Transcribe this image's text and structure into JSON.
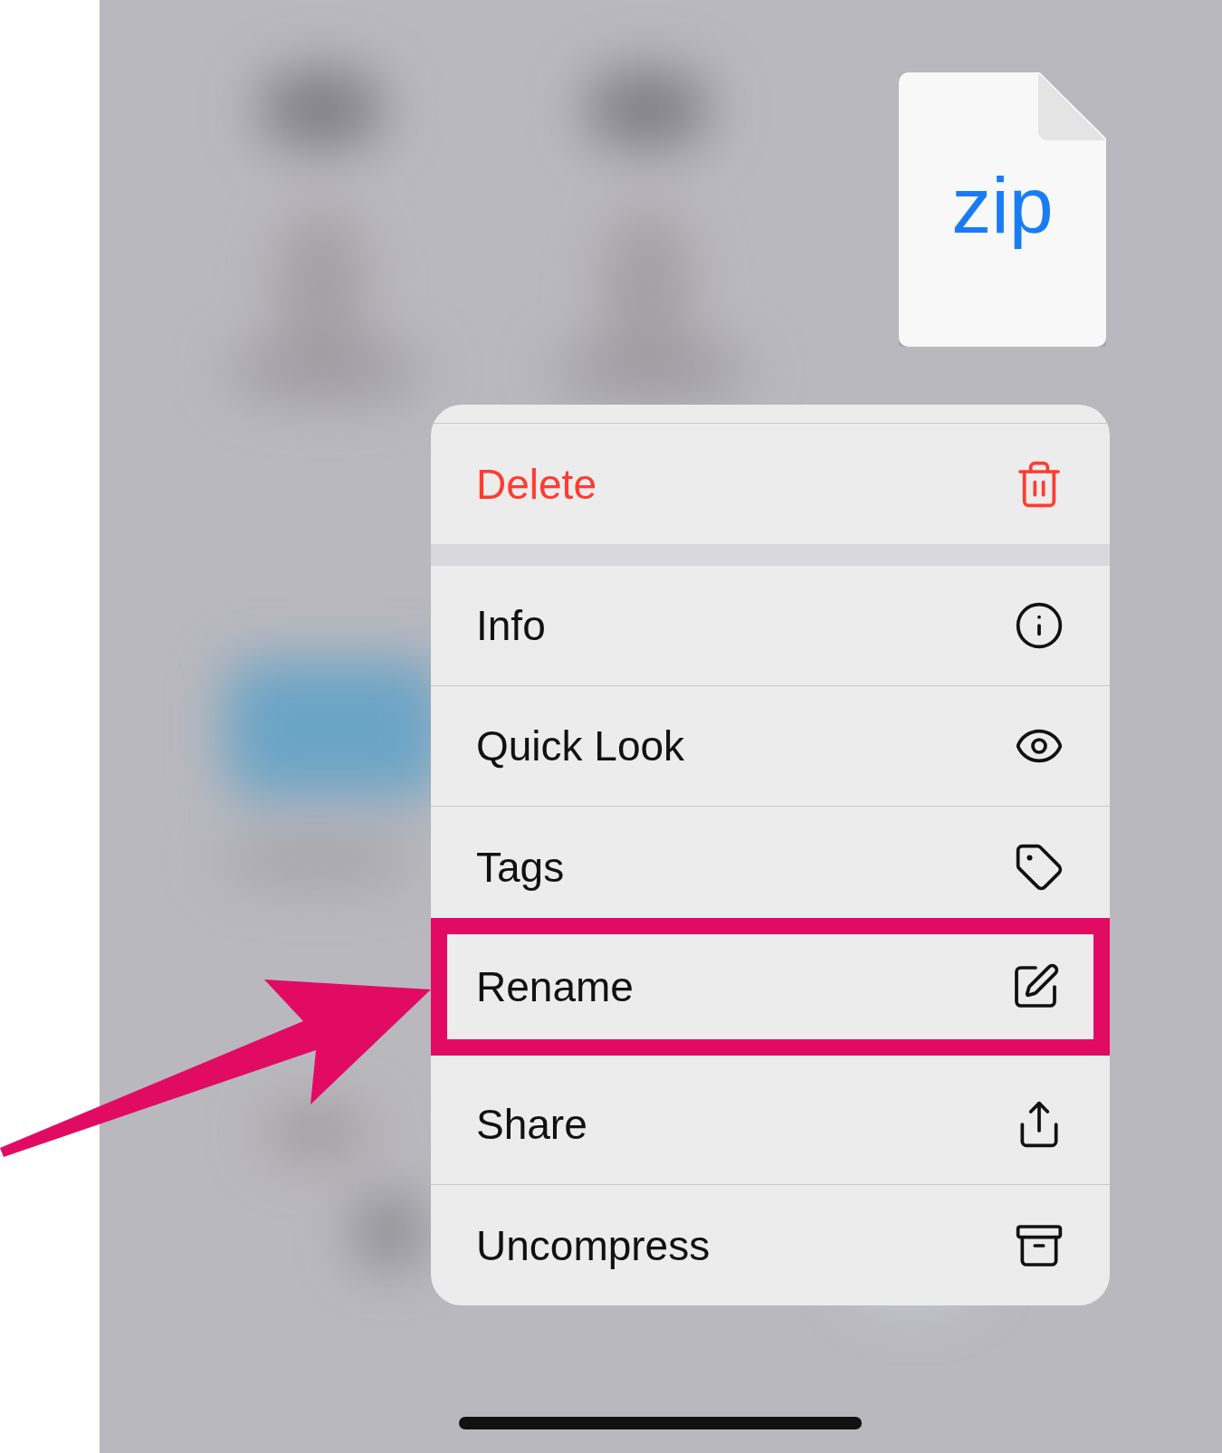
{
  "file_preview": {
    "label": "zip"
  },
  "menu": {
    "groups": [
      {
        "items": [
          {
            "label": "Delete",
            "kind": "destructive",
            "highlighted": false
          }
        ]
      },
      {
        "items": [
          {
            "label": "Info",
            "kind": "normal",
            "highlighted": false
          },
          {
            "label": "Quick Look",
            "kind": "normal",
            "highlighted": false
          },
          {
            "label": "Tags",
            "kind": "normal",
            "highlighted": false
          },
          {
            "label": "Rename",
            "kind": "normal",
            "highlighted": true
          },
          {
            "label": "Share",
            "kind": "normal",
            "highlighted": false
          },
          {
            "label": "Uncompress",
            "kind": "normal",
            "highlighted": false
          }
        ]
      }
    ]
  }
}
